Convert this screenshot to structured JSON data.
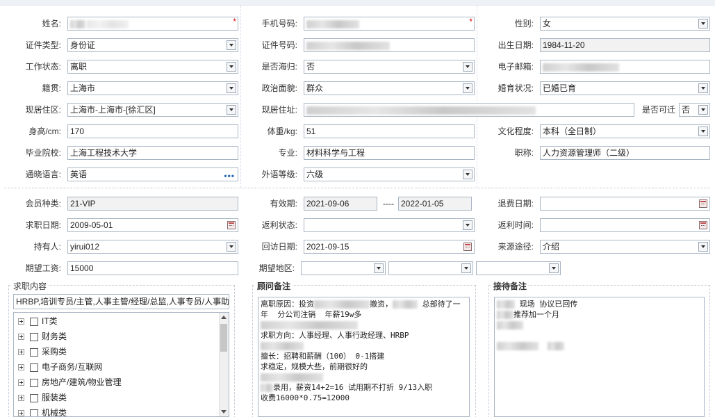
{
  "form": {
    "name_label": "姓名:",
    "phone_label": "手机号码:",
    "gender_label": "性别:",
    "gender_value": "女",
    "id_type_label": "证件类型:",
    "id_type_value": "身份证",
    "id_no_label": "证件号码:",
    "birth_label": "出生日期:",
    "birth_value": "1984-11-20",
    "work_status_label": "工作状态:",
    "work_status_value": "离职",
    "overseas_label": "是否海归:",
    "overseas_value": "否",
    "email_label": "电子邮箱:",
    "native_label": "籍贯:",
    "native_value": "上海市",
    "political_label": "政治面貌:",
    "political_value": "群众",
    "marital_label": "婚育状况:",
    "marital_value": "已婚已育",
    "residence_area_label": "现居住区:",
    "residence_area_value": "上海市-上海市-[徐汇区]",
    "address_label": "现居住址:",
    "relocate_label": "是否可迁",
    "relocate_value": "否",
    "height_label": "身高/cm:",
    "height_value": "170",
    "weight_label": "体重/kg:",
    "weight_value": "51",
    "education_label": "文化程度:",
    "education_value": "本科（全日制）",
    "school_label": "毕业院校:",
    "school_value": "上海工程技术大学",
    "major_label": "专业:",
    "major_value": "材料科学与工程",
    "title_label": "职称:",
    "title_value": "人力资源管理师（二级）",
    "language_label": "通晓语言:",
    "language_value": "英语",
    "language_more": "•••",
    "fl_level_label": "外语等级:",
    "fl_level_value": "六级"
  },
  "membership": {
    "type_label": "会员种类:",
    "type_value": "21-VIP",
    "valid_label": "有效期:",
    "valid_from": "2021-09-06",
    "valid_sep": "----",
    "valid_to": "2022-01-05",
    "refund_date_label": "退费日期:",
    "job_date_label": "求职日期:",
    "job_date_value": "2009-05-01",
    "rebate_status_label": "返利状态:",
    "rebate_time_label": "返利时间:",
    "holder_label": "持有人:",
    "holder_value": "yirui012",
    "visit_date_label": "回访日期:",
    "visit_date_value": "2021-09-15",
    "source_label": "来源途径:",
    "source_value": "介绍",
    "salary_label": "期望工资:",
    "salary_value": "15000",
    "region_label": "期望地区:"
  },
  "job_panel": {
    "title": "求职内容",
    "summary": "HRBP,培训专员/主管,人事主管/经理/总监,人事专员/人事助",
    "tree": [
      "IT类",
      "财务类",
      "采购类",
      "电子商务/互联网",
      "房地产/建筑/物业管理",
      "服装类",
      "机械类"
    ]
  },
  "consultant_panel": {
    "title": "顾问备注",
    "lines": [
      "离职原因：投资",
      "年  分公司注销  年薪19w多",
      "",
      "求职方向：人事经理、人事行政经理、HRBP",
      "",
      "擅长：招聘和薪酬（100） 0-1搭建",
      "求稳定，规模大些，前期很好的",
      "",
      "录用，薪资14+2=16 试用期不打折 9/13入职",
      "收费16000*0.75=12000"
    ],
    "line0_tail": "撤资，",
    "line0_end": "总部待了一"
  },
  "reception_panel": {
    "title": "接待备注",
    "lines": [
      "现场 协议已回传",
      "推荐加一个月"
    ]
  },
  "icons": {
    "dropdown": "chevron-down-icon",
    "calendar": "calendar-icon",
    "expand": "tree-expand-icon"
  },
  "colors": {
    "border": "#a9b6c5",
    "required": "#dd0000",
    "readonly_bg": "#f2f2f2",
    "link": "#2a6ab0"
  }
}
